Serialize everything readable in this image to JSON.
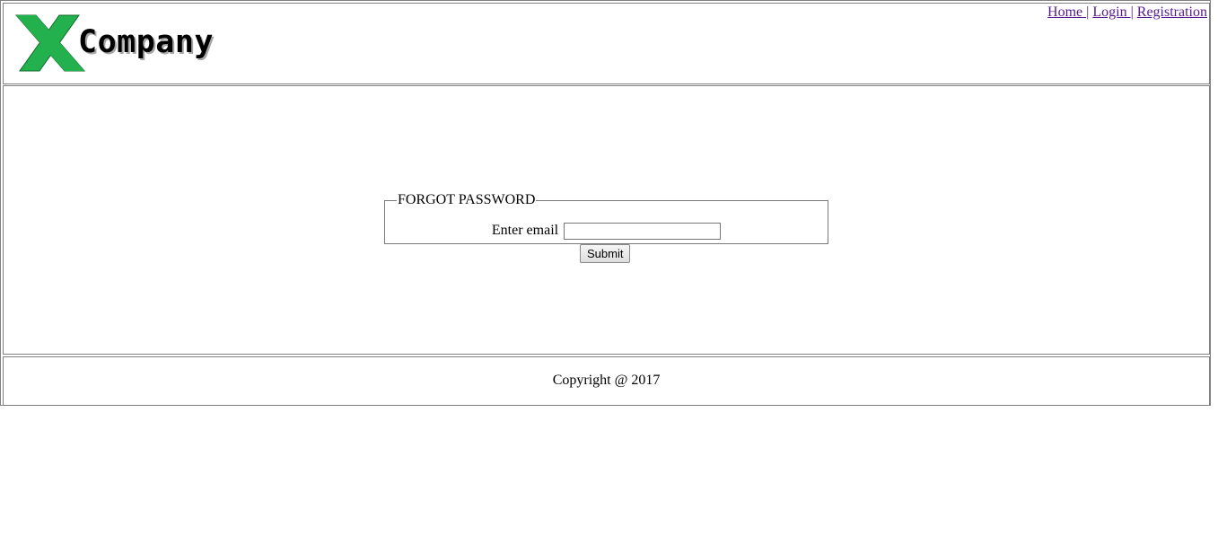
{
  "header": {
    "logo_text": "Company",
    "nav": [
      {
        "label": "Home ",
        "sep": "|"
      },
      {
        "label": "Login ",
        "sep": "|"
      },
      {
        "label": "Registration",
        "sep": ""
      }
    ]
  },
  "form": {
    "legend": "FORGOT PASSWORD",
    "email_label": "Enter email",
    "email_value": "",
    "submit_label": "Submit"
  },
  "footer": {
    "copyright": "Copyright @ 2017"
  },
  "colors": {
    "logo_green": "#22b14c",
    "link_visited": "#551a8b"
  }
}
